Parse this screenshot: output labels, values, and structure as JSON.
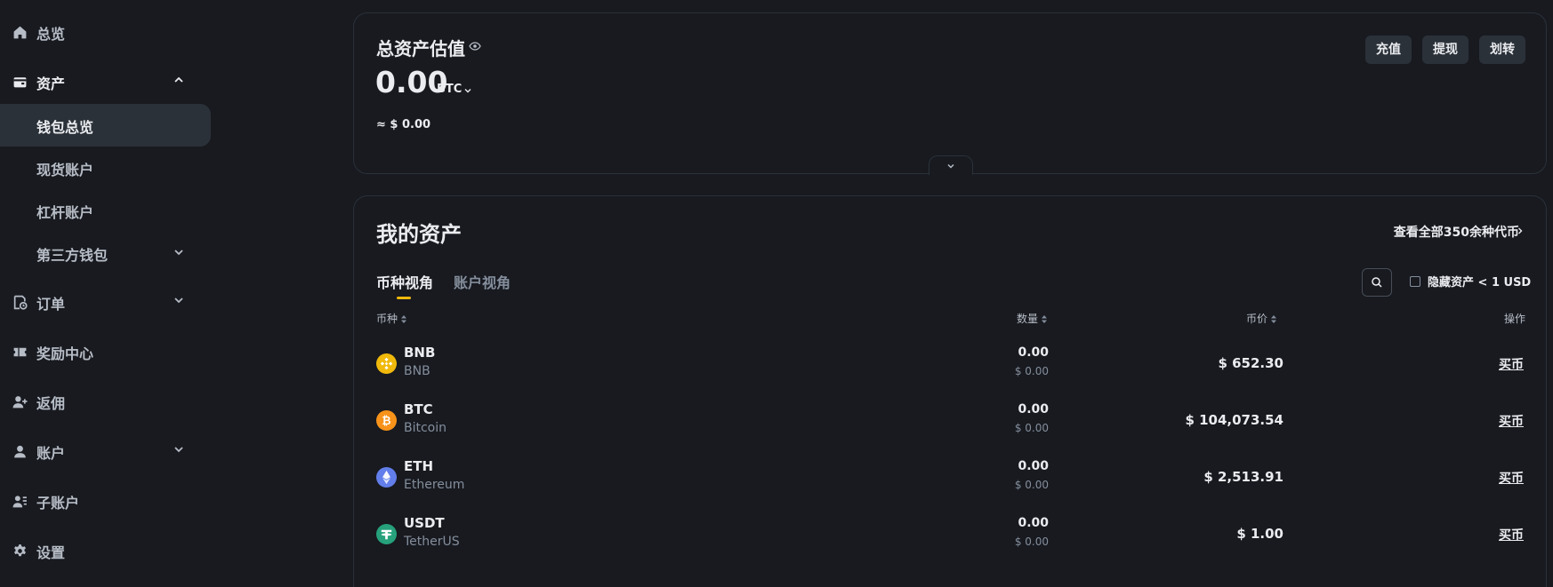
{
  "sidebar": {
    "items": [
      {
        "label": "总览",
        "icon": "home-icon"
      },
      {
        "label": "资产",
        "icon": "wallet-icon"
      },
      {
        "label": "订单",
        "icon": "order-icon"
      },
      {
        "label": "奖励中心",
        "icon": "ticket-icon"
      },
      {
        "label": "返佣",
        "icon": "user-plus-icon"
      },
      {
        "label": "账户",
        "icon": "user-icon"
      },
      {
        "label": "子账户",
        "icon": "sub-account-icon"
      },
      {
        "label": "设置",
        "icon": "gear-icon"
      }
    ],
    "assets_sub": [
      {
        "label": "钱包总览",
        "active": true
      },
      {
        "label": "现货账户"
      },
      {
        "label": "杠杆账户"
      },
      {
        "label": "第三方钱包"
      }
    ]
  },
  "total": {
    "title": "总资产估值",
    "amount": "0.00",
    "unit": "BTC",
    "approx": "≈ $ 0.00",
    "buttons": {
      "deposit": "充值",
      "withdraw": "提现",
      "transfer": "划转"
    }
  },
  "assets": {
    "title": "我的资产",
    "view_all": "查看全部350余种代币",
    "tabs": [
      "币种视角",
      "账户视角"
    ],
    "hide_small": "隐藏资产 < 1 USD",
    "columns": {
      "coin": "币种",
      "qty": "数量",
      "price": "币价",
      "op": "操作"
    },
    "rows": [
      {
        "symbol": "BNB",
        "name": "BNB",
        "qty": "0.00",
        "qty_usd": "$ 0.00",
        "price": "$ 652.30",
        "action": "买币",
        "color": "#f0b90b"
      },
      {
        "symbol": "BTC",
        "name": "Bitcoin",
        "qty": "0.00",
        "qty_usd": "$ 0.00",
        "price": "$ 104,073.54",
        "action": "买币",
        "color": "#f7931a"
      },
      {
        "symbol": "ETH",
        "name": "Ethereum",
        "qty": "0.00",
        "qty_usd": "$ 0.00",
        "price": "$ 2,513.91",
        "action": "买币",
        "color": "#627eea"
      },
      {
        "symbol": "USDT",
        "name": "TetherUS",
        "qty": "0.00",
        "qty_usd": "$ 0.00",
        "price": "$ 1.00",
        "action": "买币",
        "color": "#26a17b"
      }
    ]
  }
}
